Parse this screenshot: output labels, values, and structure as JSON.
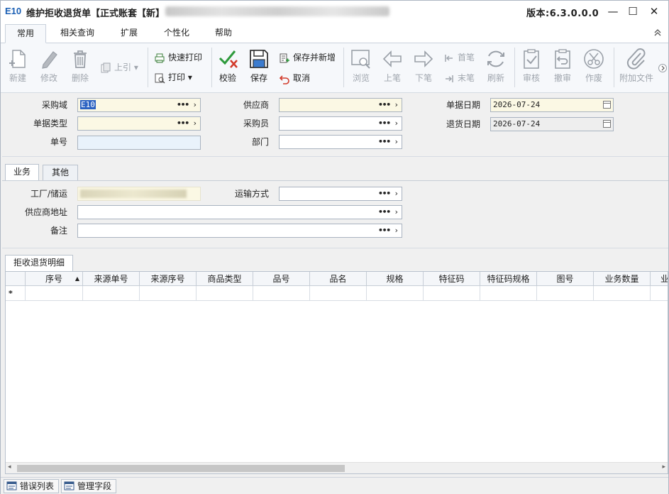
{
  "window": {
    "logo": "E10",
    "title": "维护拒收退货单【正式账套【新】",
    "version": "版本:6.3.0.0.0",
    "controls": {
      "minimize": "—",
      "maximize": "☐",
      "close": "✕"
    }
  },
  "ribbon_tabs": [
    "常用",
    "相关查询",
    "扩展",
    "个性化",
    "帮助"
  ],
  "toolbar": {
    "new": "新建",
    "edit": "修改",
    "delete": "删除",
    "pull_up": "上引",
    "quick_print": "快速打印",
    "print": "打印",
    "validate": "校验",
    "save": "保存",
    "save_and_new": "保存并新增",
    "cancel": "取消",
    "browse": "浏览",
    "prev": "上笔",
    "next": "下笔",
    "first": "首笔",
    "last": "末笔",
    "refresh": "刷新",
    "approve": "审核",
    "unapprove": "撤审",
    "void": "作废",
    "attach": "附加文件"
  },
  "form": {
    "purchase_domain_label": "采购域",
    "purchase_domain_value": "E10",
    "doc_type_label": "单据类型",
    "doc_no_label": "单号",
    "supplier_label": "供应商",
    "buyer_label": "采购员",
    "department_label": "部门",
    "doc_date_label": "单据日期",
    "doc_date_value": "2026-07-24",
    "return_date_label": "退货日期",
    "return_date_value": "2026-07-24"
  },
  "sub_tabs": [
    "业务",
    "其他"
  ],
  "business": {
    "plant_label": "工厂/储运",
    "shipping_label": "运输方式",
    "supplier_address_label": "供应商地址",
    "remark_label": "备注"
  },
  "detail_tab": "拒收退货明细",
  "grid": {
    "columns": [
      "序号",
      "来源单号",
      "来源序号",
      "商品类型",
      "品号",
      "品名",
      "规格",
      "特征码",
      "特征码规格",
      "图号",
      "业务数量",
      "业"
    ],
    "new_row_marker": "*"
  },
  "statusbar": [
    "错误列表",
    "管理字段"
  ]
}
